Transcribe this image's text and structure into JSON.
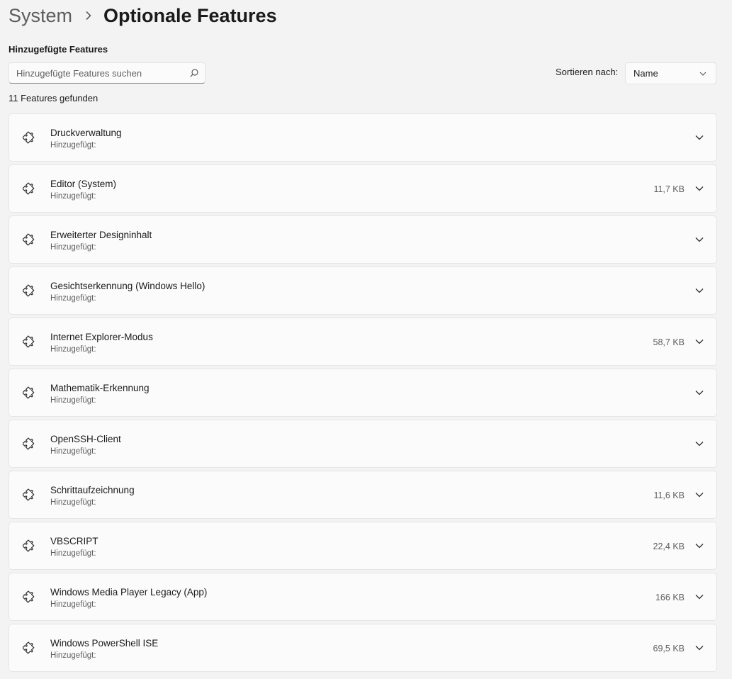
{
  "breadcrumb": {
    "parent": "System",
    "current": "Optionale Features"
  },
  "installed": {
    "title": "Hinzugefügte Features",
    "search_placeholder": "Hinzugefügte Features suchen",
    "sort_label": "Sortieren nach:",
    "sort_value": "Name",
    "count_text": "11 Features gefunden"
  },
  "features": [
    {
      "name": "Druckverwaltung",
      "added": "Hinzugefügt:",
      "size": ""
    },
    {
      "name": "Editor (System)",
      "added": "Hinzugefügt:",
      "size": "11,7 KB"
    },
    {
      "name": "Erweiterter Designinhalt",
      "added": "Hinzugefügt:",
      "size": ""
    },
    {
      "name": "Gesichtserkennung (Windows Hello)",
      "added": "Hinzugefügt:",
      "size": ""
    },
    {
      "name": "Internet Explorer-Modus",
      "added": "Hinzugefügt:",
      "size": "58,7 KB"
    },
    {
      "name": "Mathematik-Erkennung",
      "added": "Hinzugefügt:",
      "size": ""
    },
    {
      "name": "OpenSSH-Client",
      "added": "Hinzugefügt:",
      "size": ""
    },
    {
      "name": "Schrittaufzeichnung",
      "added": "Hinzugefügt:",
      "size": "11,6 KB"
    },
    {
      "name": "VBSCRIPT",
      "added": "Hinzugefügt:",
      "size": "22,4 KB"
    },
    {
      "name": "Windows Media Player Legacy (App)",
      "added": "Hinzugefügt:",
      "size": "166 KB"
    },
    {
      "name": "Windows PowerShell ISE",
      "added": "Hinzugefügt:",
      "size": "69,5 KB"
    }
  ],
  "icons": {
    "feature": "puzzle-icon",
    "expand": "chevron-down-icon",
    "search": "search-icon",
    "breadcrumb_separator": "chevron-right-icon"
  },
  "colors": {
    "background": "#f3f3f3",
    "card": "#fbfbfb",
    "secondary_text": "#5f5f5f"
  }
}
